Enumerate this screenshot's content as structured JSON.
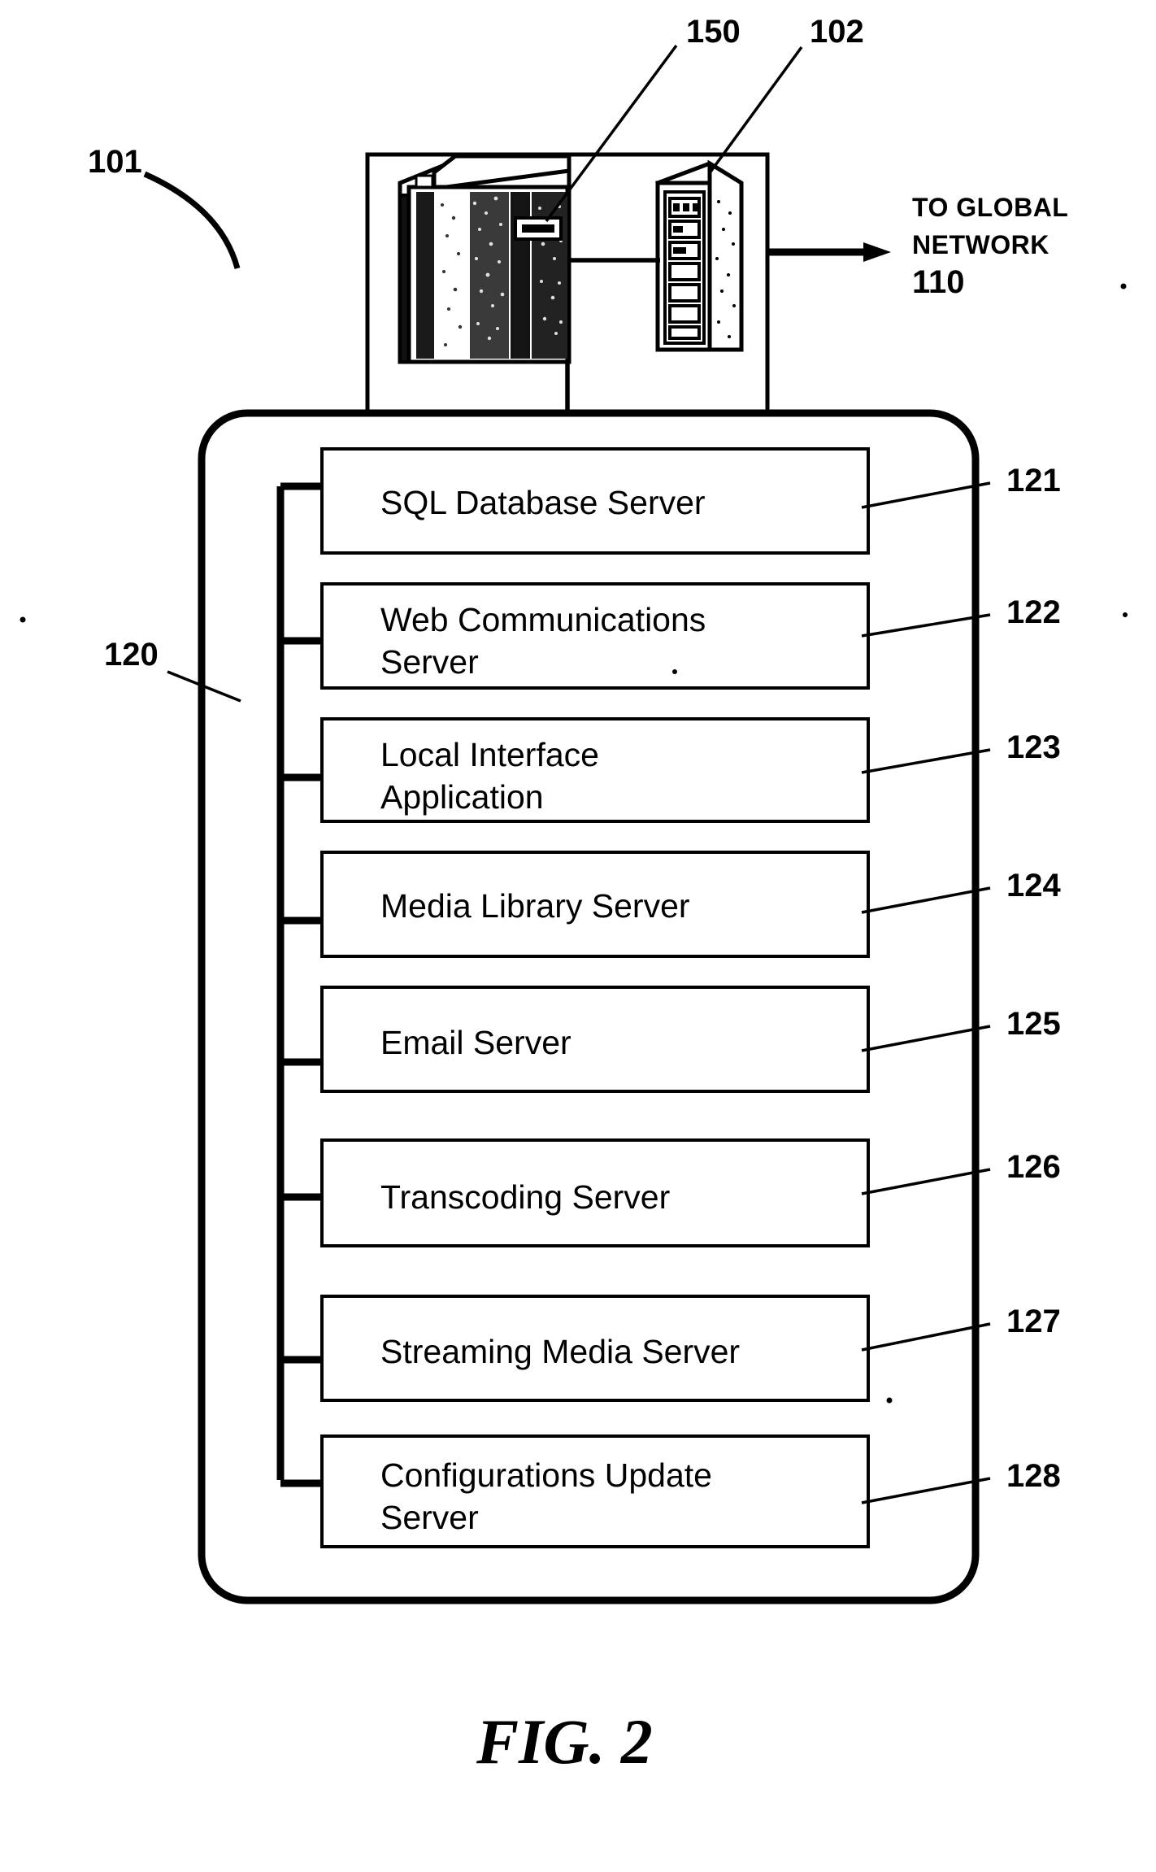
{
  "figure": {
    "caption": "FIG. 2",
    "system_ref": "101",
    "enclosure_ref": "120"
  },
  "hardware": {
    "mainframe_ref": "150",
    "tower_ref": "102",
    "network_label_line1": "TO GLOBAL",
    "network_label_line2": "NETWORK",
    "network_label_ref": "110"
  },
  "components": [
    {
      "label": "SQL Database Server",
      "label2": "",
      "ref": "121"
    },
    {
      "label": "Web Communications",
      "label2": "Server",
      "ref": "122"
    },
    {
      "label": "Local Interface",
      "label2": "Application",
      "ref": "123"
    },
    {
      "label": "Media Library Server",
      "label2": "",
      "ref": "124"
    },
    {
      "label": "Email Server",
      "label2": "",
      "ref": "125"
    },
    {
      "label": "Transcoding Server",
      "label2": "",
      "ref": "126"
    },
    {
      "label": "Streaming Media Server",
      "label2": "",
      "ref": "127"
    },
    {
      "label": "Configurations Update",
      "label2": "Server",
      "ref": "128"
    }
  ],
  "colors": {
    "ink": "#000000",
    "paper": "#ffffff"
  }
}
